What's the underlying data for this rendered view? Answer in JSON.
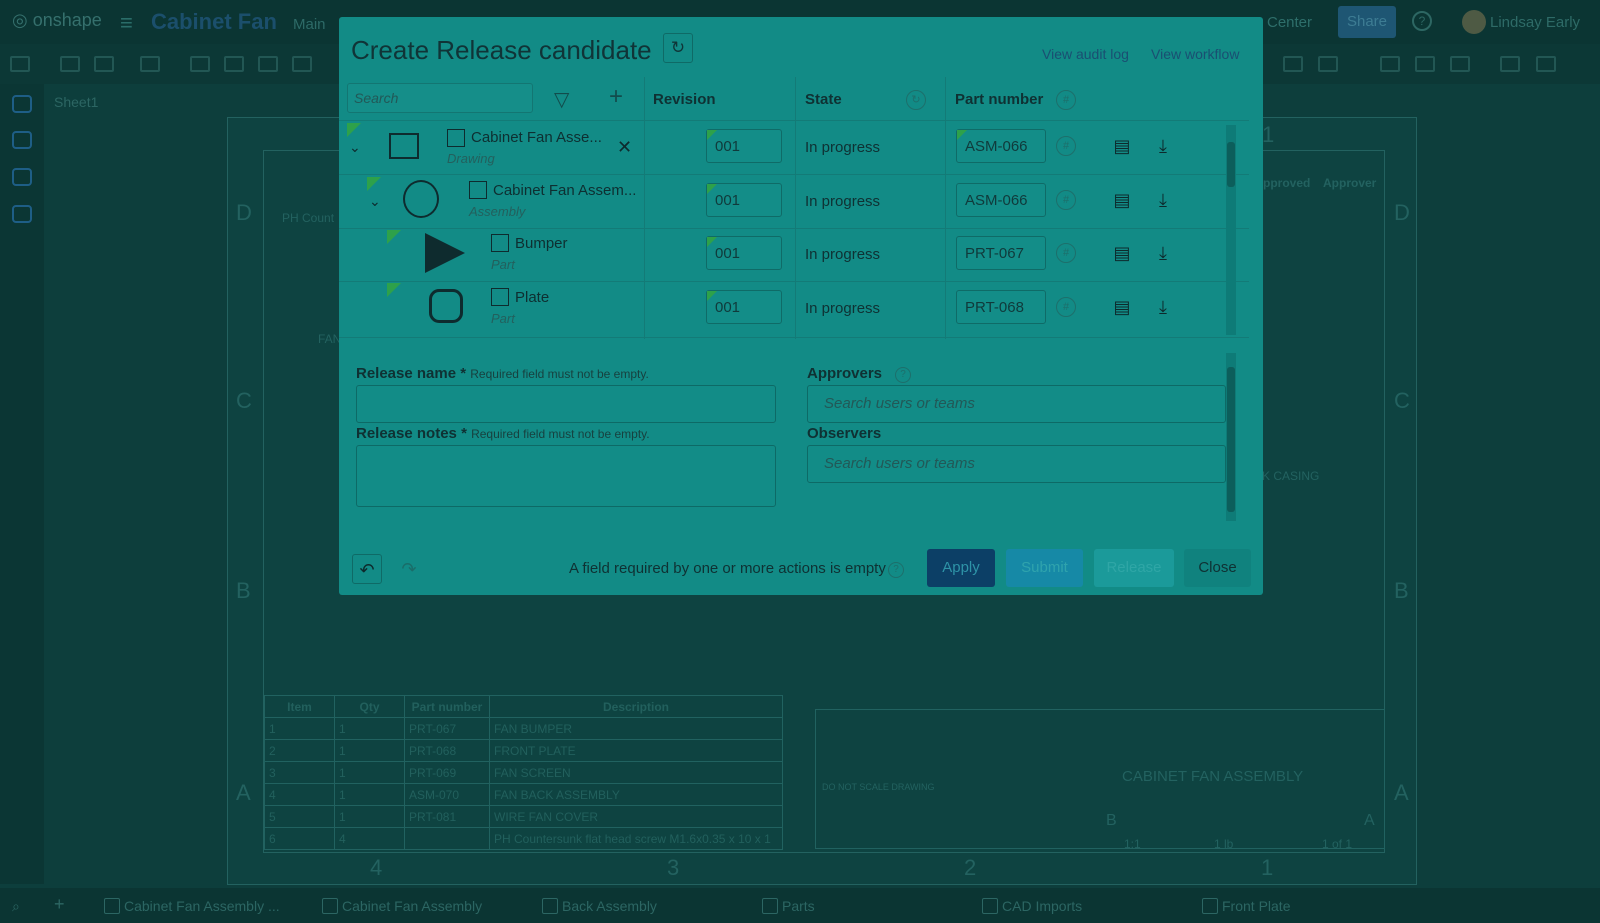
{
  "app": {
    "logo": "onshape",
    "doc_title": "Cabinet Fan",
    "branch": "Main",
    "learning_center": "Center",
    "share": "Share",
    "help": "?",
    "user": "Lindsay Early"
  },
  "sheet": {
    "tab": "Sheet1",
    "zones_rows": [
      "D",
      "C",
      "B",
      "A"
    ],
    "zones_cols": [
      "4",
      "3",
      "2",
      "1"
    ],
    "pf_label": "PH Count",
    "fan_label": "FAN",
    "casing_label": "K CASING",
    "approver_headers": [
      "pproved",
      "Approver"
    ]
  },
  "bom": {
    "headers": [
      "Item",
      "Qty",
      "Part number",
      "Description"
    ],
    "rows": [
      [
        "1",
        "1",
        "PRT-067",
        "FAN BUMPER"
      ],
      [
        "2",
        "1",
        "PRT-068",
        "FRONT PLATE"
      ],
      [
        "3",
        "1",
        "PRT-069",
        "FAN SCREEN"
      ],
      [
        "4",
        "1",
        "ASM-070",
        "FAN BACK ASSEMBLY"
      ],
      [
        "5",
        "1",
        "PRT-081",
        "WIRE FAN COVER"
      ],
      [
        "6",
        "4",
        "",
        "PH Countersunk flat head screw M1.6x0.35 x 10 x 1"
      ]
    ]
  },
  "title_block": {
    "title": "CABINET FAN ASSEMBLY",
    "size": "B",
    "rev": "A",
    "scale": "1:1",
    "weight": "1 lb",
    "sheet": "1 of 1",
    "do_not_scale": "DO NOT SCALE DRAWING"
  },
  "bottom_tabs": [
    "Cabinet Fan Assembly ...",
    "Cabinet Fan Assembly",
    "Back Assembly",
    "Parts",
    "CAD Imports",
    "Front Plate"
  ],
  "modal": {
    "title": "Create Release candidate",
    "audit_link": "View audit log",
    "workflow_link": "View workflow",
    "search_placeholder": "Search",
    "col_revision": "Revision",
    "col_state": "State",
    "col_part_number": "Part number",
    "items": [
      {
        "name": "Cabinet Fan Asse...",
        "type": "Drawing",
        "revision": "001",
        "state": "In progress",
        "part_number": "ASM-066"
      },
      {
        "name": "Cabinet Fan Assem...",
        "type": "Assembly",
        "revision": "001",
        "state": "In progress",
        "part_number": "ASM-066"
      },
      {
        "name": "Bumper",
        "type": "Part",
        "revision": "001",
        "state": "In progress",
        "part_number": "PRT-067"
      },
      {
        "name": "Plate",
        "type": "Part",
        "revision": "001",
        "state": "In progress",
        "part_number": "PRT-068"
      }
    ],
    "release_name_label": "Release name",
    "release_notes_label": "Release notes",
    "required_marker": "*",
    "required_msg": "Required field must not be empty.",
    "approvers_label": "Approvers",
    "observers_label": "Observers",
    "users_placeholder": "Search users or teams",
    "footer_msg": "A field required by one or more actions is empty",
    "buttons": {
      "apply": "Apply",
      "submit": "Submit",
      "release": "Release",
      "close": "Close"
    }
  }
}
